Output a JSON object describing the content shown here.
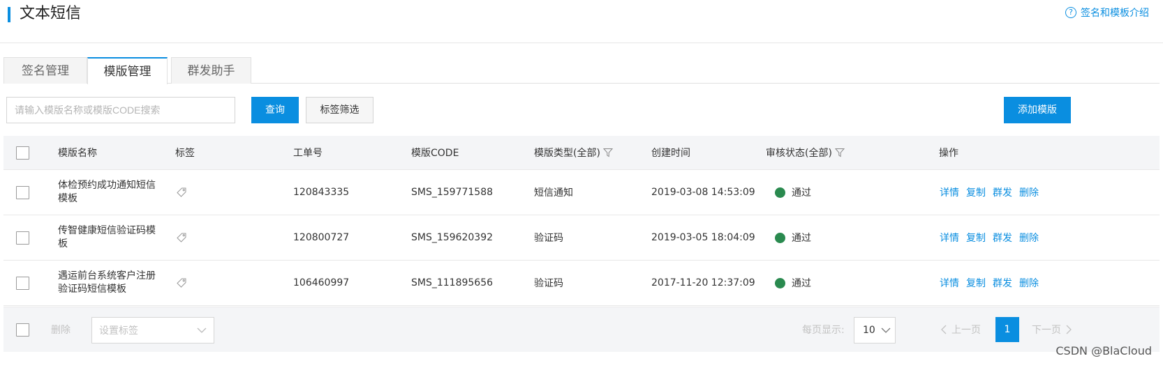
{
  "header": {
    "title": "文本短信",
    "help_label": "签名和模板介绍",
    "help_icon": "question-circle-icon"
  },
  "tabs": [
    {
      "label": "签名管理",
      "active": false
    },
    {
      "label": "模版管理",
      "active": true
    },
    {
      "label": "群发助手",
      "active": false
    }
  ],
  "toolbar": {
    "search_placeholder": "请输入模版名称或模版CODE搜索",
    "query_label": "查询",
    "tag_filter_label": "标签筛选",
    "add_label": "添加模版"
  },
  "table": {
    "columns": {
      "name": "模版名称",
      "tag": "标签",
      "ticket": "工单号",
      "code": "模版CODE",
      "type": "模版类型(全部)",
      "created": "创建时间",
      "status": "审核状态(全部)",
      "actions": "操作"
    },
    "rows": [
      {
        "name": "体检预约成功通知短信模板",
        "ticket": "120843335",
        "code": "SMS_159771588",
        "type": "短信通知",
        "created": "2019-03-08 14:53:09",
        "status": "通过"
      },
      {
        "name": "传智健康短信验证码模板",
        "ticket": "120800727",
        "code": "SMS_159620392",
        "type": "验证码",
        "created": "2019-03-05 18:04:09",
        "status": "通过"
      },
      {
        "name": "遇运前台系统客户注册验证码短信模板",
        "ticket": "106460997",
        "code": "SMS_111895656",
        "type": "验证码",
        "created": "2017-11-20 12:37:09",
        "status": "通过"
      }
    ],
    "action_labels": {
      "detail": "详情",
      "copy": "复制",
      "broadcast": "群发",
      "delete": "删除"
    }
  },
  "footer": {
    "delete_label": "删除",
    "set_tag_label": "设置标签",
    "page_size_label": "每页显示:",
    "page_size_value": "10",
    "prev_label": "上一页",
    "current_page": "1",
    "next_label": "下一页"
  },
  "watermark": "CSDN @BlaCloud",
  "colors": {
    "accent": "#0a8ee0",
    "status_ok": "#2a8a4f",
    "header_bg": "#f4f5f7"
  }
}
